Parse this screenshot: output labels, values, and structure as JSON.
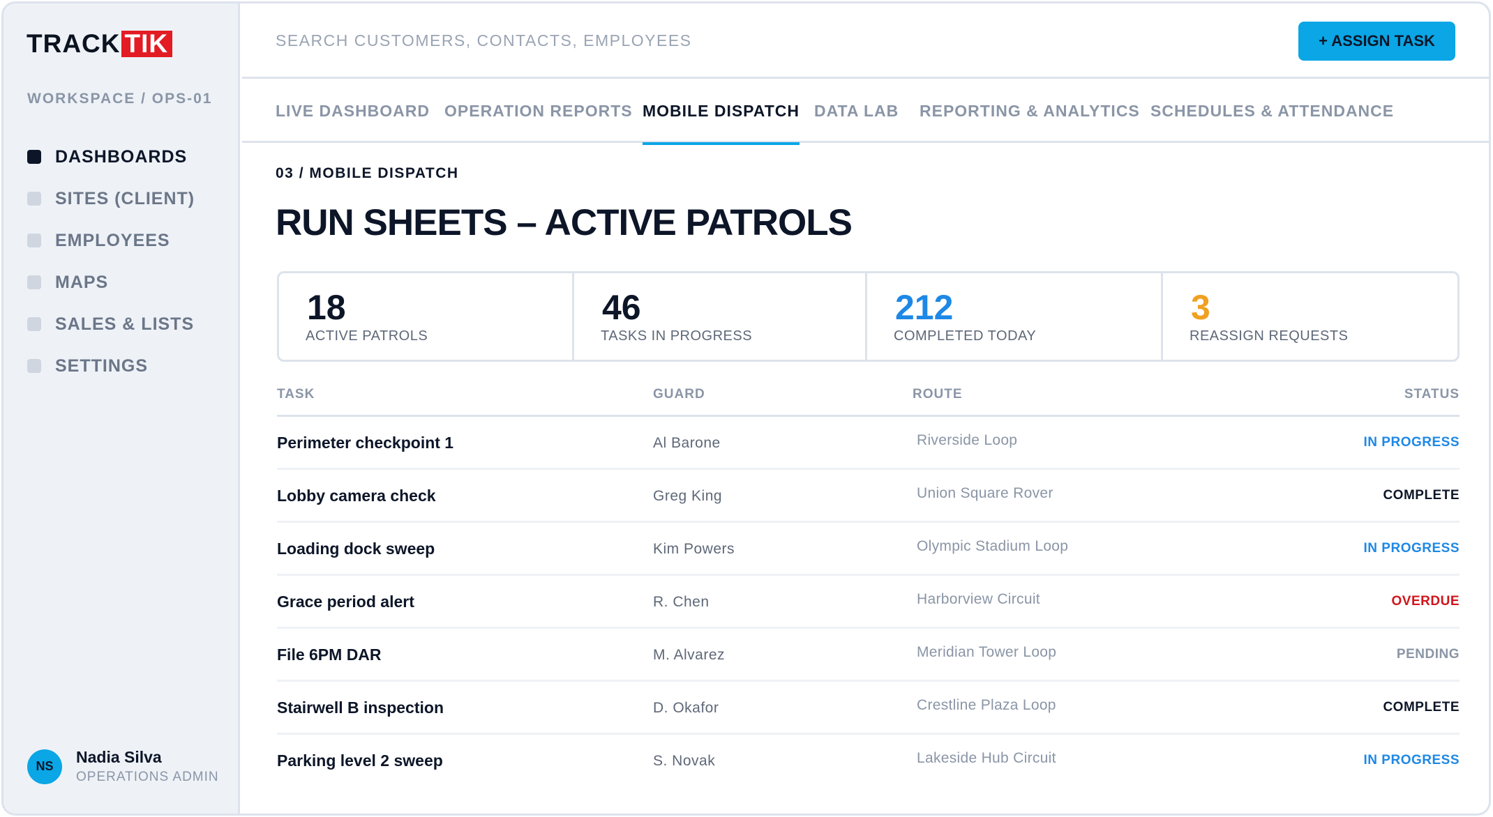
{
  "brand": {
    "logo_part1": "TRACK",
    "logo_part2": "TIK"
  },
  "workspace": "WORKSPACE / OPS-01",
  "sidebar": {
    "items": [
      {
        "label": "DASHBOARDS",
        "active": true
      },
      {
        "label": "SITES (CLIENT)",
        "active": false
      },
      {
        "label": "EMPLOYEES",
        "active": false
      },
      {
        "label": "MAPS",
        "active": false
      },
      {
        "label": "SALES & LISTS",
        "active": false
      },
      {
        "label": "SETTINGS",
        "active": false
      }
    ]
  },
  "user": {
    "initials": "NS",
    "name": "Nadia Silva",
    "role": "OPERATIONS ADMIN"
  },
  "search": {
    "placeholder": "SEARCH CUSTOMERS, CONTACTS, EMPLOYEES"
  },
  "assign_button": "+ ASSIGN TASK",
  "tabs": [
    {
      "label": "LIVE DASHBOARD",
      "active": false
    },
    {
      "label": "OPERATION REPORTS",
      "active": false
    },
    {
      "label": "MOBILE DISPATCH",
      "active": true
    },
    {
      "label": "DATA LAB",
      "active": false
    },
    {
      "label": "REPORTING & ANALYTICS",
      "active": false
    },
    {
      "label": "SCHEDULES & ATTENDANCE",
      "active": false
    }
  ],
  "breadcrumb": "03 / MOBILE DISPATCH",
  "page_title": "RUN SHEETS – ACTIVE PATROLS",
  "stats": [
    {
      "value": "18",
      "label": "ACTIVE PATROLS",
      "color": "#0d1628"
    },
    {
      "value": "46",
      "label": "TASKS IN PROGRESS",
      "color": "#0d1628"
    },
    {
      "value": "212",
      "label": "COMPLETED TODAY",
      "color": "#1e88e5"
    },
    {
      "value": "3",
      "label": "REASSIGN REQUESTS",
      "color": "#f0a020"
    }
  ],
  "table": {
    "headers": {
      "task": "TASK",
      "guard": "GUARD",
      "route": "ROUTE",
      "status": "STATUS"
    },
    "rows": [
      {
        "task": "Perimeter checkpoint 1",
        "guard": "Al Barone",
        "route": "Riverside Loop",
        "status": "IN PROGRESS"
      },
      {
        "task": "Lobby camera check",
        "guard": "Greg King",
        "route": "Union Square Rover",
        "status": "COMPLETE"
      },
      {
        "task": "Loading dock sweep",
        "guard": "Kim Powers",
        "route": "Olympic Stadium Loop",
        "status": "IN PROGRESS"
      },
      {
        "task": "Grace period alert",
        "guard": "R. Chen",
        "route": "Harborview Circuit",
        "status": "OVERDUE"
      },
      {
        "task": "File 6PM DAR",
        "guard": "M. Alvarez",
        "route": "Meridian Tower Loop",
        "status": "PENDING"
      },
      {
        "task": "Stairwell B inspection",
        "guard": "D. Okafor",
        "route": "Crestline Plaza Loop",
        "status": "COMPLETE"
      },
      {
        "task": "Parking level 2 sweep",
        "guard": "S. Novak",
        "route": "Lakeside Hub Circuit",
        "status": "IN PROGRESS"
      }
    ]
  },
  "status_colors": {
    "IN PROGRESS": "#1e88e5",
    "COMPLETE": "#0d1628",
    "OVERDUE": "#d0141c",
    "PENDING": "#8a95a6"
  },
  "colors": {
    "accent": "#0aa6e6",
    "brand_red": "#e31b23"
  }
}
